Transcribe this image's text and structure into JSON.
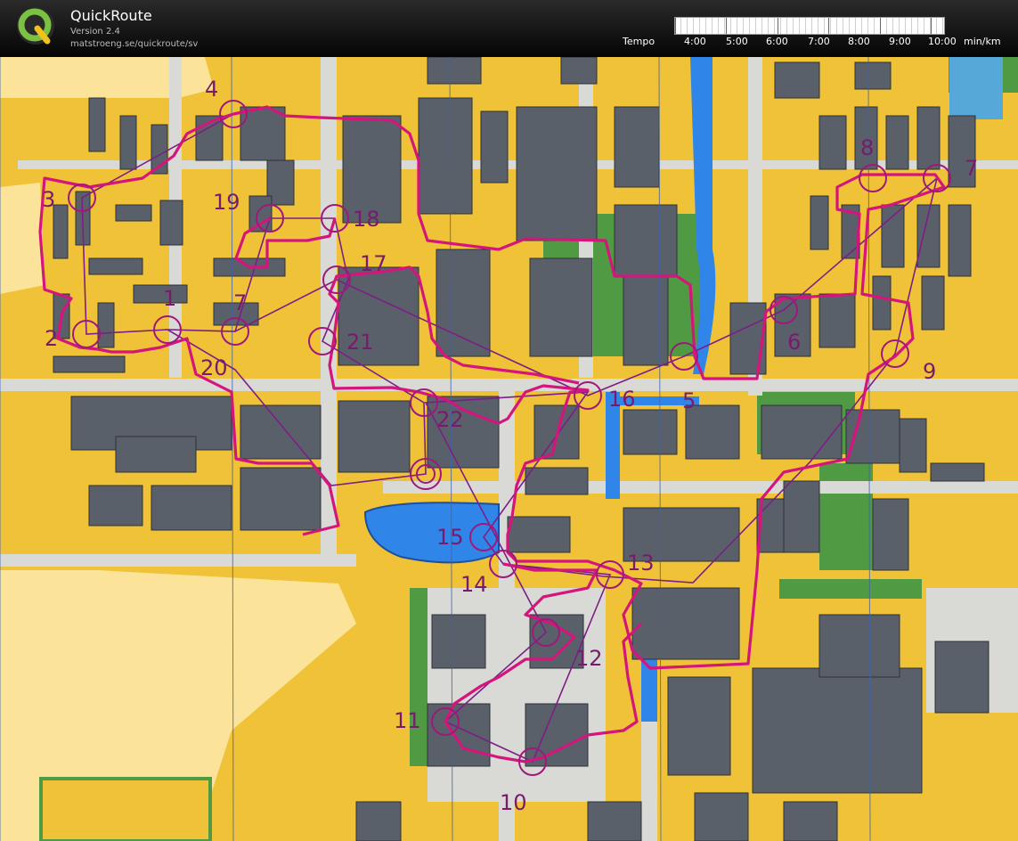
{
  "app": {
    "title": "QuickRoute",
    "version": "Version 2.4",
    "url": "matstroeng.se/quickroute/sv"
  },
  "tempo": {
    "label": "Tempo",
    "ticks": [
      "4:00",
      "5:00",
      "6:00",
      "7:00",
      "8:00",
      "9:00",
      "10:00"
    ],
    "unit": "min/km"
  },
  "map": {
    "control_numbers": [
      "1",
      "2",
      "3",
      "4",
      "5",
      "6",
      "7",
      "8",
      "9",
      "10",
      "11",
      "12",
      "13",
      "14",
      "15",
      "16",
      "17",
      "18",
      "19",
      "20",
      "21",
      "22"
    ],
    "colors": {
      "route": "#d4157c",
      "control": "#a0187a",
      "open_land": "#f0c238",
      "rough_open": "#fbe49a",
      "building": "#59606a",
      "paved": "#d9d9d6",
      "green": "#4f9a42",
      "water": "#2f86e8"
    }
  }
}
